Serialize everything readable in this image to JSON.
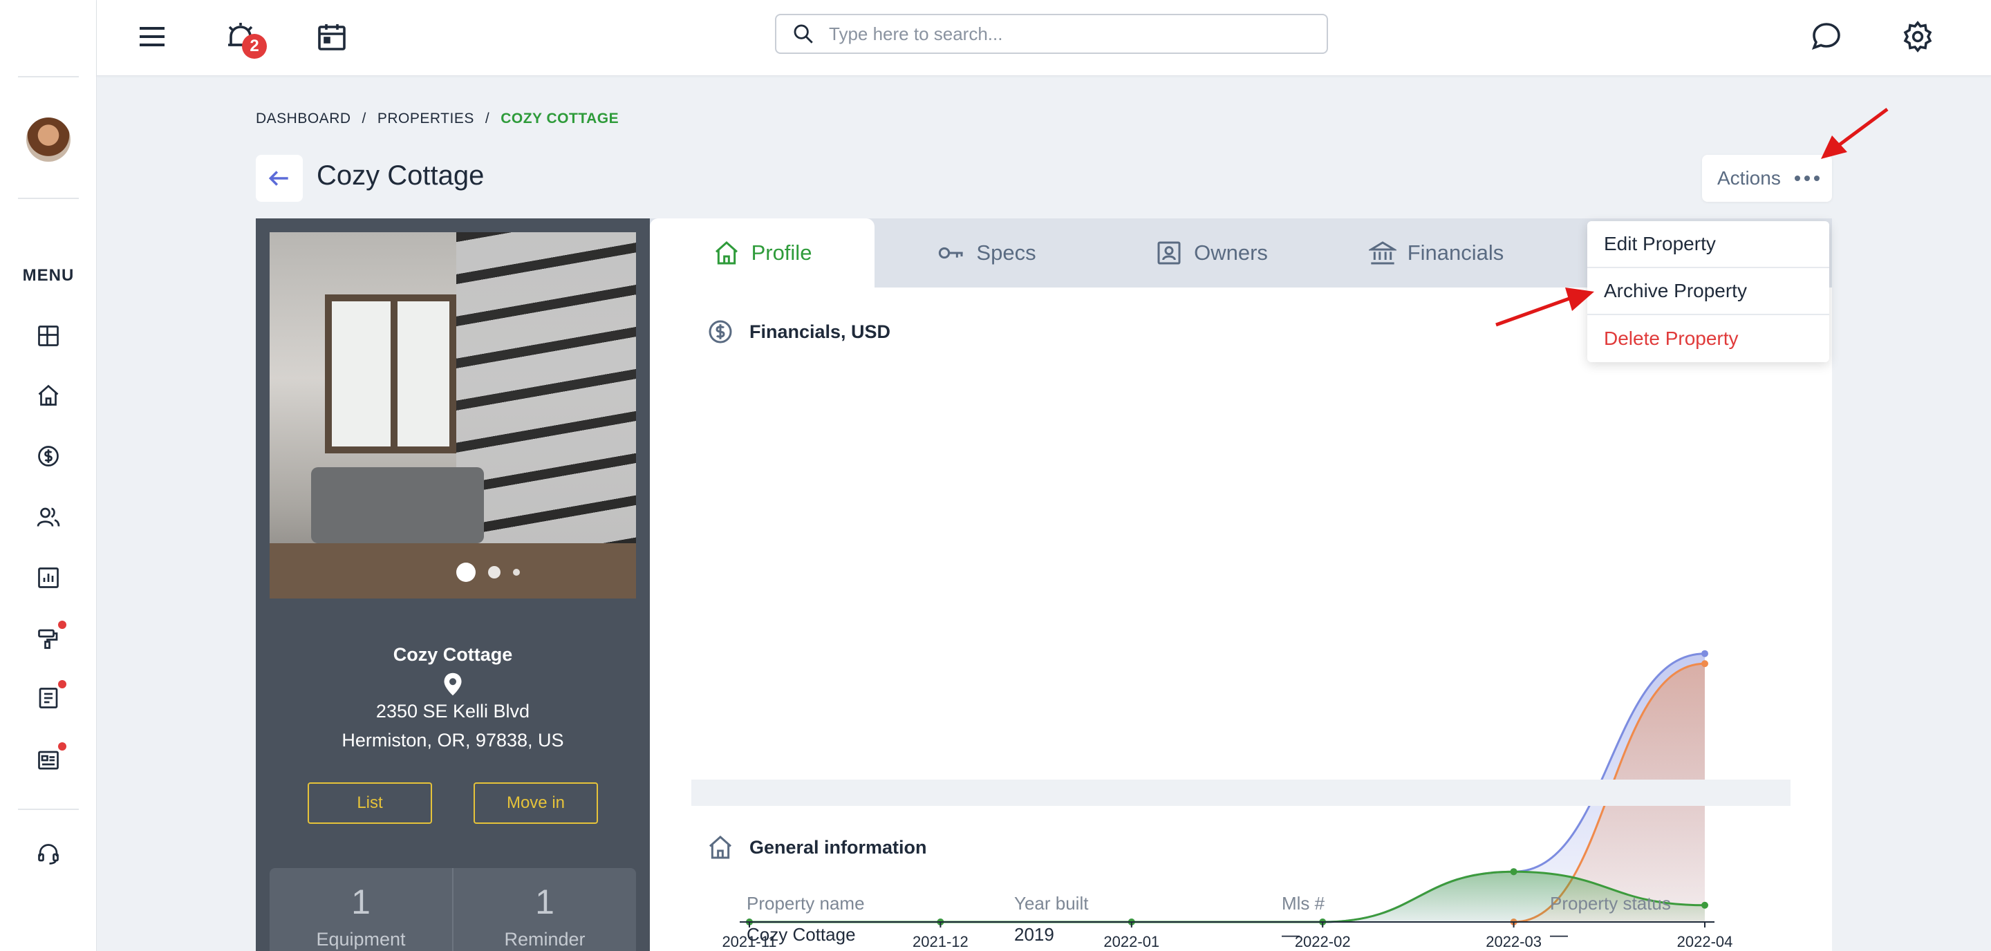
{
  "topbar": {
    "notification_count": "2",
    "search_placeholder": "Type here to search..."
  },
  "sidebar": {
    "menu_label": "MENU"
  },
  "breadcrumb": {
    "items": [
      "DASHBOARD",
      "PROPERTIES",
      "COZY COTTAGE"
    ]
  },
  "page": {
    "title": "Cozy Cottage",
    "actions_label": "Actions"
  },
  "actions_menu": {
    "items": [
      "Edit Property",
      "Archive Property",
      "Delete Property"
    ]
  },
  "property": {
    "name": "Cozy Cottage",
    "address_line1": "2350 SE Kelli Blvd",
    "address_line2": "Hermiston, OR, 97838, US",
    "list_button": "List",
    "move_in_button": "Move in",
    "stats": [
      {
        "value": "1",
        "label": "Equipment"
      },
      {
        "value": "1",
        "label": "Reminder"
      }
    ]
  },
  "tabs": [
    "Profile",
    "Specs",
    "Owners",
    "Financials"
  ],
  "financials": {
    "title": "Financials, USD"
  },
  "chart_data": {
    "type": "area",
    "categories": [
      "2021-11",
      "2021-12",
      "2022-01",
      "2022-02",
      "2022-03",
      "2022-04"
    ],
    "series": [
      {
        "color": "#7c8ce0",
        "values": [
          0,
          0,
          0,
          0,
          15,
          80
        ]
      },
      {
        "color": "#f08a4b",
        "values": [
          null,
          null,
          null,
          null,
          0,
          77
        ]
      },
      {
        "color": "#3c9b3c",
        "values": [
          0,
          0,
          0,
          0,
          15,
          5
        ]
      }
    ],
    "ylim": [
      0,
      82
    ],
    "grid": false,
    "legend": "none"
  },
  "general": {
    "title": "General information",
    "fields": [
      {
        "label": "Property name",
        "value": "Cozy Cottage"
      },
      {
        "label": "Year built",
        "value": "2019"
      },
      {
        "label": "Mls #",
        "value": "—"
      },
      {
        "label": "Property status",
        "value": "—"
      }
    ]
  },
  "colors": {
    "accent_green": "#2e9b3a",
    "danger_red": "#e03a3a",
    "button_yellow": "#e6c33a",
    "card_dark": "#4a525d"
  }
}
